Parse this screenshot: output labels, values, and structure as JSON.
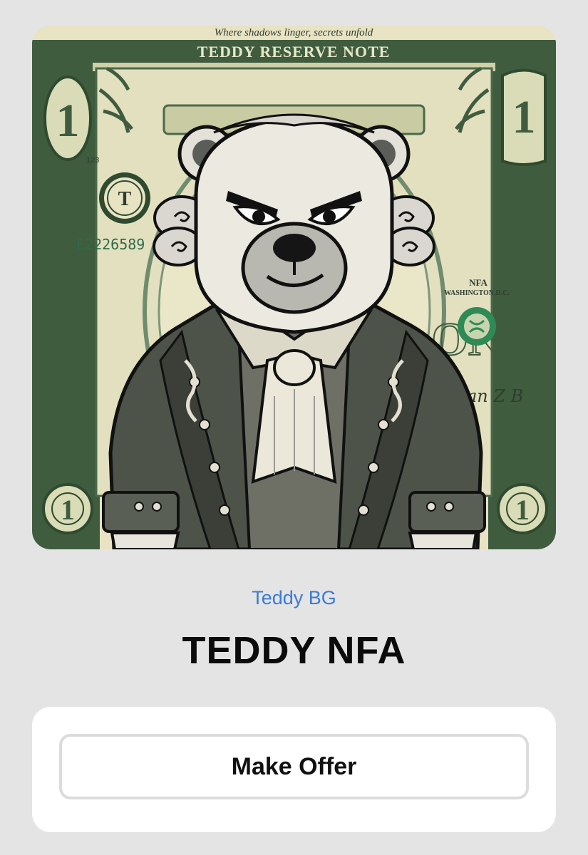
{
  "nft": {
    "artwork": {
      "top_motto": "Where shadows linger, secrets unfold",
      "banner": "TEDDY RESERVE NOTE",
      "denomination": "1",
      "seal_letter": "T",
      "plate_number": "123",
      "serial_number": "E2226589",
      "issuer": "NFA",
      "city": "WASHINGTON,D.C.",
      "word_one": "ONE",
      "signature": "Dan Z B"
    },
    "creator": "Teddy BG",
    "title": "TEDDY NFA"
  },
  "actions": {
    "offer_label": "Make Offer"
  },
  "colors": {
    "page_bg": "#e4e4e4",
    "creator_link": "#3a7bd5",
    "bill_green": "#3d5a3d",
    "bill_paper": "#e8e4c4"
  }
}
